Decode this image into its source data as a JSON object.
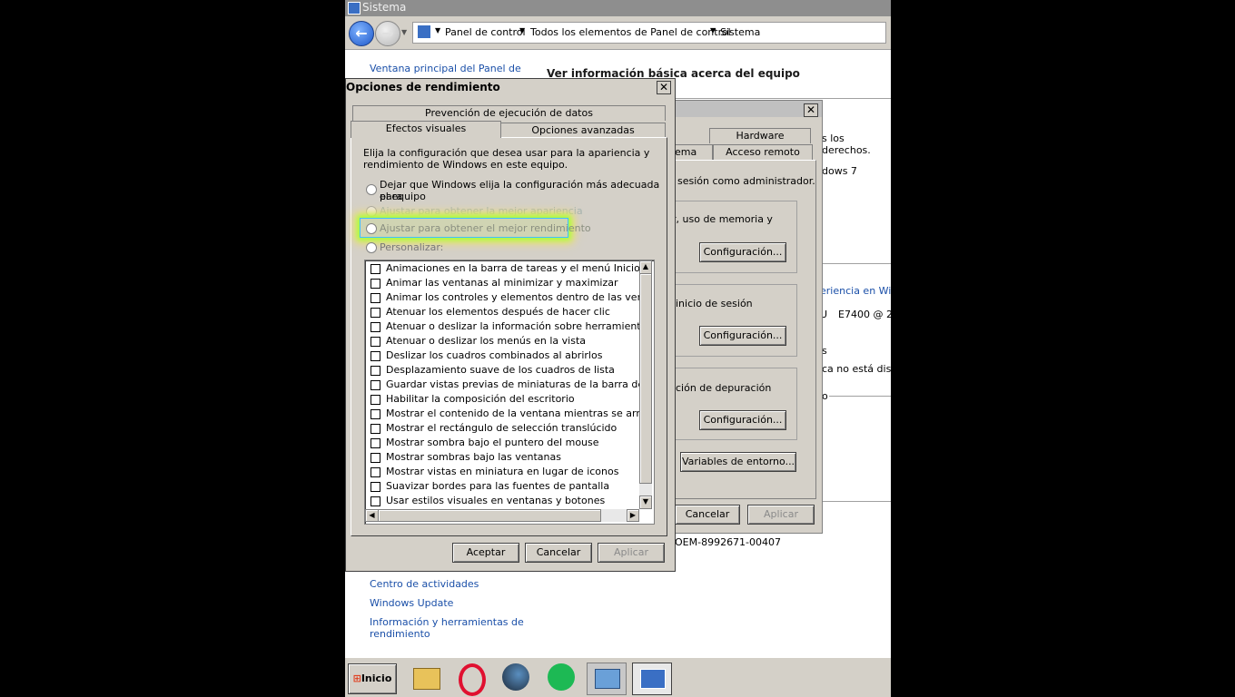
{
  "window": {
    "title": "Sistema"
  },
  "breadcrumbs": [
    "Panel de control",
    "Todos los elementos de Panel de control",
    "Sistema"
  ],
  "left_panel": {
    "home_link": "Ventana principal del Panel de",
    "see_also": [
      "Centro de actividades",
      "Windows Update",
      "Información y herramientas de",
      "rendimiento"
    ]
  },
  "main": {
    "heading": "Ver información básica acerca del equipo",
    "fragments": [
      "s los derechos.",
      "dows 7",
      "eriencia en Wind",
      "U",
      "E7400  @ 2.",
      "s",
      "ca no está dispo",
      "o",
      "OEM-8992671-00407"
    ]
  },
  "sys_props": {
    "tabs_row1": [
      "Hardware"
    ],
    "tabs_row2": [
      "tema",
      "Acceso remoto"
    ],
    "admin_note": "sesión como administrador.",
    "perf_text": "r, uso de memoria y",
    "profile_text": "inicio de sesión",
    "startup_text": "ción de depuración",
    "config_label": "Configuración...",
    "env_button": "Variables de entorno...",
    "cancel": "Cancelar",
    "apply": "Aplicar"
  },
  "perf_dialog": {
    "title": "Opciones de rendimiento",
    "tabs_back": [
      "Prevención de ejecución de datos"
    ],
    "tabs_front": [
      "Efectos visuales",
      "Opciones avanzadas"
    ],
    "intro": [
      "Elija la configuración que desea usar para la apariencia y",
      "rendimiento de Windows en este equipo."
    ],
    "radios": [
      {
        "label": "Dejar que Windows elija la configuración más adecuada para",
        "label2": "el equipo"
      },
      {
        "label": "Ajustar para obtener la mejor apariencia"
      },
      {
        "label": "Ajustar para obtener el mejor rendimiento"
      },
      {
        "label": "Personalizar:"
      }
    ],
    "checkboxes": [
      "Animaciones en la barra de tareas y el menú Inicio",
      "Animar las ventanas al minimizar y maximizar",
      "Animar los controles y elementos dentro de las ventanas",
      "Atenuar los elementos después de hacer clic",
      "Atenuar o deslizar la información sobre herramientas en la",
      "Atenuar o deslizar los menús en la vista",
      "Deslizar los cuadros combinados al abrirlos",
      "Desplazamiento suave de los cuadros de lista",
      "Guardar vistas previas de miniaturas de la barra de tareas",
      "Habilitar la composición del escritorio",
      "Mostrar el contenido de la ventana mientras se arrastra",
      "Mostrar el rectángulo de selección translúcido",
      "Mostrar sombra bajo el puntero del mouse",
      "Mostrar sombras bajo las ventanas",
      "Mostrar vistas en miniatura en lugar de iconos",
      "Suavizar bordes para las fuentes de pantalla",
      "Usar estilos visuales en ventanas y botones"
    ],
    "ok": "Aceptar",
    "cancel": "Cancelar",
    "apply": "Aplicar"
  },
  "taskbar": {
    "start_label": "Inicio",
    "apps": [
      "file-explorer-icon",
      "opera-icon",
      "steam-icon",
      "spotify-icon",
      "control-panel-icon",
      "system-icon"
    ]
  }
}
